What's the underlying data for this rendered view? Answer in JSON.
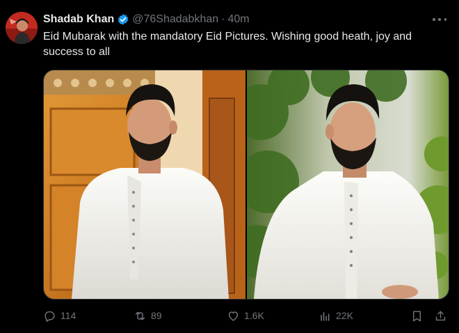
{
  "author": {
    "name": "Shadab Khan",
    "handle": "@76Shadabkhan",
    "separator": "·",
    "time": "40m"
  },
  "tweet": {
    "text": "Eid Mubarak with the mandatory Eid Pictures. Wishing good heath, joy and success to all"
  },
  "media": [
    {
      "description_icon": "photo-left"
    },
    {
      "description_icon": "photo-right"
    }
  ],
  "actions": {
    "replies": "114",
    "reposts": "89",
    "likes": "1.6K",
    "views": "22K"
  },
  "colors": {
    "background": "#000000",
    "text": "#e7e9ea",
    "muted": "#71767b",
    "verified": "#1d9bf0"
  }
}
